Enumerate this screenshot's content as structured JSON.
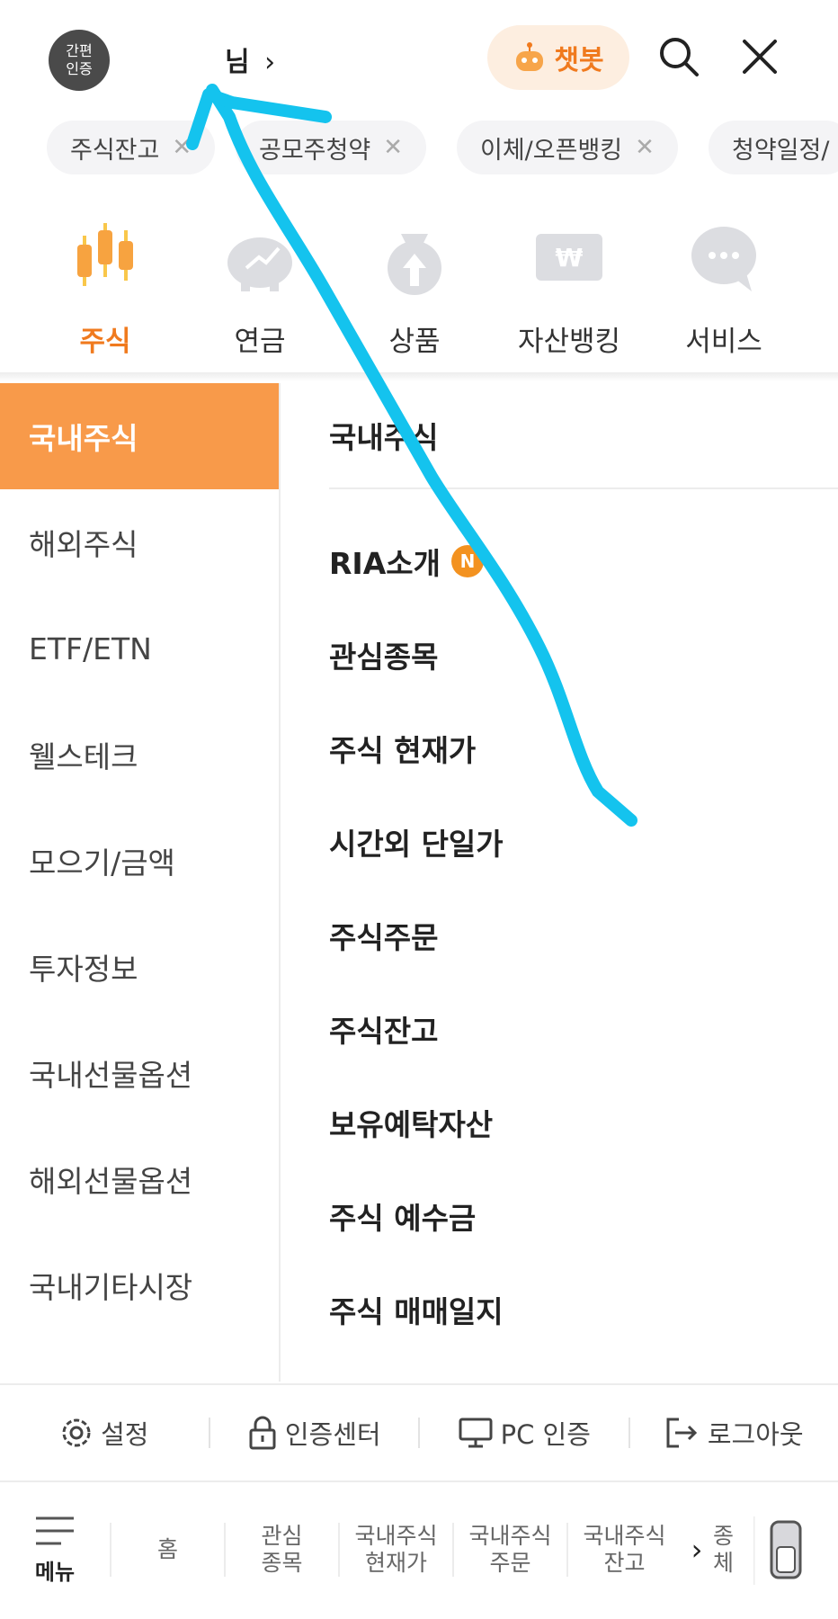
{
  "header": {
    "auth_badge": "간편\n인증",
    "user_name": "님",
    "user_chevron": "›",
    "chatbot_label": "챗봇"
  },
  "chips": [
    {
      "label": "주식잔고",
      "close": "✕"
    },
    {
      "label": "공모주청약",
      "close": "✕"
    },
    {
      "label": "이체/오픈뱅킹",
      "close": "✕"
    },
    {
      "label": "청약일정/"
    }
  ],
  "categories": [
    {
      "label": "주식",
      "active": true
    },
    {
      "label": "연금"
    },
    {
      "label": "상품"
    },
    {
      "label": "자산뱅킹"
    },
    {
      "label": "서비스"
    }
  ],
  "left_menu": [
    {
      "label": "국내주식",
      "active": true
    },
    {
      "label": "해외주식"
    },
    {
      "label": "ETF/ETN"
    },
    {
      "label": "웰스테크"
    },
    {
      "label": "모으기/금액"
    },
    {
      "label": "투자정보"
    },
    {
      "label": "국내선물옵션"
    },
    {
      "label": "해외선물옵션"
    },
    {
      "label": "국내기타시장"
    }
  ],
  "right_panel": {
    "title": "국내주식",
    "items": [
      {
        "label": "RIA소개",
        "badge": "N"
      },
      {
        "label": "관심종목"
      },
      {
        "label": "주식 현재가"
      },
      {
        "label": "시간외 단일가"
      },
      {
        "label": "주식주문"
      },
      {
        "label": "주식잔고"
      },
      {
        "label": "보유예탁자산"
      },
      {
        "label": "주식 예수금"
      },
      {
        "label": "주식 매매일지"
      }
    ]
  },
  "footer_links": [
    {
      "label": "설정",
      "icon": "gear-icon"
    },
    {
      "label": "인증센터",
      "icon": "lock-icon"
    },
    {
      "label": "PC 인증",
      "icon": "monitor-icon"
    },
    {
      "label": "로그아웃",
      "icon": "logout-icon"
    }
  ],
  "bottom_nav": {
    "menu_label": "메뉴",
    "quick_links": [
      "홈",
      "관심\n종목",
      "국내주식\n현재가",
      "국내주식\n주문",
      "국내주식\n잔고"
    ],
    "chevron": "›",
    "cut_label": "종\n체"
  },
  "colors": {
    "accent": "#f07a1e",
    "active_bg": "#f89a4a",
    "annotation_stroke": "#14c3ee"
  }
}
